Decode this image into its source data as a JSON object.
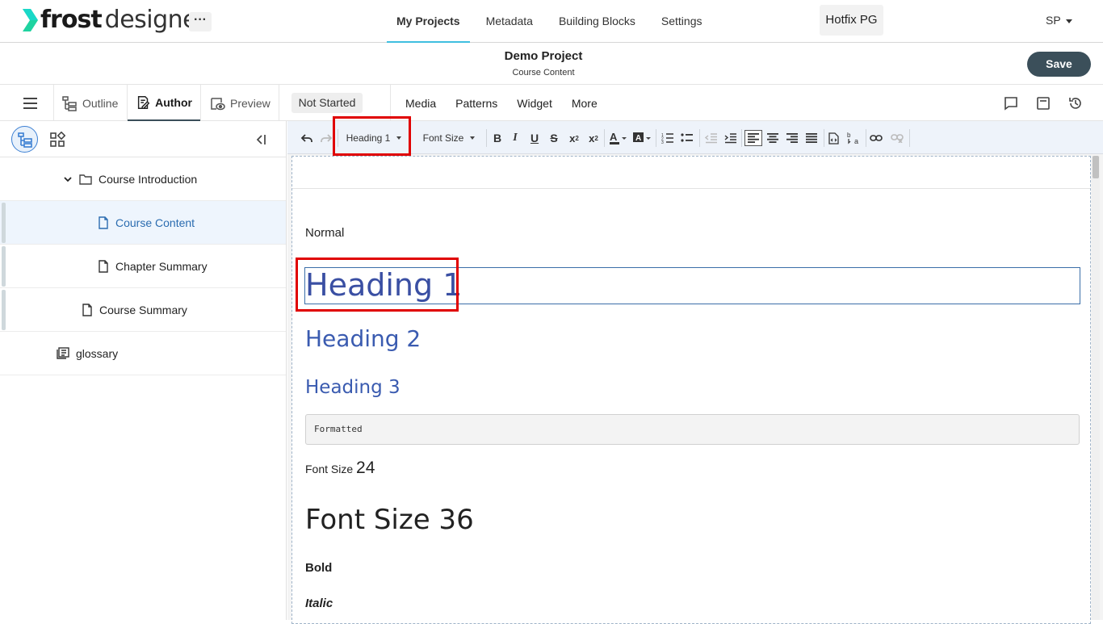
{
  "brand": {
    "frost": "frost",
    "designer": "designer",
    "more_label": "···",
    "mark_color": "#1fd3a0"
  },
  "nav": {
    "tabs": [
      {
        "label": "My Projects",
        "active": true
      },
      {
        "label": "Metadata"
      },
      {
        "label": "Building Blocks"
      },
      {
        "label": "Settings"
      }
    ],
    "org": "Hotfix PG",
    "user": "SP"
  },
  "project": {
    "title": "Demo Project",
    "subtitle": "Course Content",
    "save_label": "Save"
  },
  "modes": {
    "outline": "Outline",
    "author": "Author",
    "preview": "Preview",
    "status": "Not Started",
    "insert": [
      "Media",
      "Patterns",
      "Widget",
      "More"
    ]
  },
  "tree": [
    {
      "label": "Course Introduction",
      "icon": "folder-icon"
    },
    {
      "label": "Course Content",
      "icon": "page-icon",
      "active": true
    },
    {
      "label": "Chapter Summary",
      "icon": "page-icon"
    },
    {
      "label": "Course Summary",
      "icon": "page-icon"
    },
    {
      "label": "glossary",
      "icon": "glossary-icon"
    }
  ],
  "toolbar": {
    "format_value": "Heading 1",
    "fontsize_value": "Font Size"
  },
  "content": {
    "normal": "Normal",
    "h1": "Heading 1",
    "h2": "Heading 2",
    "h3": "Heading 3",
    "pre": "Formatted",
    "fs24_prefix": "Font Size",
    "fs24_value": "24",
    "fs36": "Font Size 36",
    "bold": "Bold",
    "italic": "Italic"
  },
  "colors": {
    "accent": "#3fbfe0",
    "save": "#3b4f5a",
    "heading": "#3a4fa3",
    "highlight": "#e00000"
  }
}
